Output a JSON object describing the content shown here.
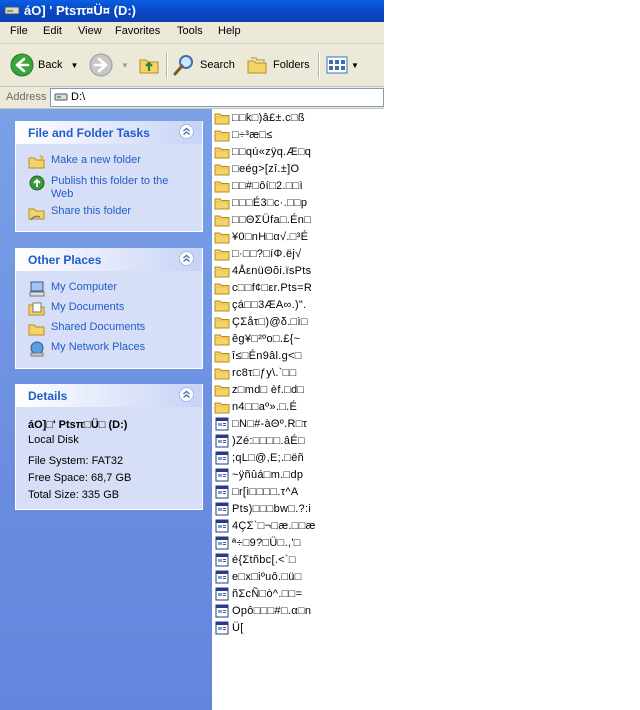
{
  "window": {
    "title": "áO] ' Ptsπ¤Ü¤ (D:)"
  },
  "menu": [
    "File",
    "Edit",
    "View",
    "Favorites",
    "Tools",
    "Help"
  ],
  "toolbar": {
    "back": "Back",
    "search": "Search",
    "folders": "Folders"
  },
  "address": {
    "label": "Address",
    "value": "D:\\"
  },
  "tasks": {
    "title": "File and Folder Tasks",
    "items": [
      "Make a new folder",
      "Publish this folder to the Web",
      "Share this folder"
    ]
  },
  "other_places": {
    "title": "Other Places",
    "items": [
      "My Computer",
      "My Documents",
      "Shared Documents",
      "My Network Places"
    ]
  },
  "details": {
    "title": "Details",
    "name": "áO]□' Ptsπ□Ü□ (D:)",
    "type": "Local Disk",
    "fs": "File System: FAT32",
    "free": "Free Space: 68,7 GB",
    "total": "Total Size: 335 GB"
  },
  "files": [
    {
      "name": "□□k□)â£±.c□ß",
      "kind": "folder"
    },
    {
      "name": "□÷³æ□≤",
      "kind": "folder"
    },
    {
      "name": "□□qú«zÿq.Æ□q",
      "kind": "folder"
    },
    {
      "name": "□eég>[zî.±]O",
      "kind": "folder"
    },
    {
      "name": "□□#□ôí□2.□□ì",
      "kind": "folder"
    },
    {
      "name": "□□□É3□c·.□□p",
      "kind": "folder"
    },
    {
      "name": "□□ΘΣÜfa□.Én□",
      "kind": "folder"
    },
    {
      "name": "¥0□nH□α√.□³É",
      "kind": "folder"
    },
    {
      "name": "□·□□?□íΦ.ëj√",
      "kind": "folder"
    },
    {
      "name": "4ÅεnüΘõi.ïsPts",
      "kind": "folder"
    },
    {
      "name": "c□□f¢□εr.Pts=R",
      "kind": "folder"
    },
    {
      "name": "çá□□3ÆA∞.)\".",
      "kind": "folder"
    },
    {
      "name": "ÇΣåτ□)@δ.□ì□",
      "kind": "folder"
    },
    {
      "name": "êg¥□²ºo□.£{~",
      "kind": "folder"
    },
    {
      "name": "î≤□Én9âl.g<□",
      "kind": "folder"
    },
    {
      "name": "rc8τ□ƒy\\.`□□",
      "kind": "folder"
    },
    {
      "name": "z□md□ èf.□d□",
      "kind": "folder"
    },
    {
      "name": "n4□□aº».□.É",
      "kind": "folder"
    },
    {
      "name": "□N□#-àΘº.R□τ",
      "kind": "file"
    },
    {
      "name": ")Zé:□□□□.âÉ□",
      "kind": "file"
    },
    {
      "name": ";qL□@,E;.□ëñ",
      "kind": "file"
    },
    {
      "name": "~ÿñûá□m.□dp",
      "kind": "file"
    },
    {
      "name": "□r[ì□□□□.τ^A",
      "kind": "file"
    },
    {
      "name": "Pts)□□□bw□.?:i",
      "kind": "file"
    },
    {
      "name": "4ÇΣ`□¬□æ.□□æ",
      "kind": "file"
    },
    {
      "name": "ª÷□9?□Ü□.,'□",
      "kind": "file"
    },
    {
      "name": "é{Σtñbc[.<`□",
      "kind": "file"
    },
    {
      "name": "e□x□iºuô.□ü□",
      "kind": "file"
    },
    {
      "name": "ñΣcÑ□ò^.□□=",
      "kind": "file"
    },
    {
      "name": "Opô□□□#□.α□n",
      "kind": "file"
    },
    {
      "name": "Ü[",
      "kind": "file"
    }
  ]
}
